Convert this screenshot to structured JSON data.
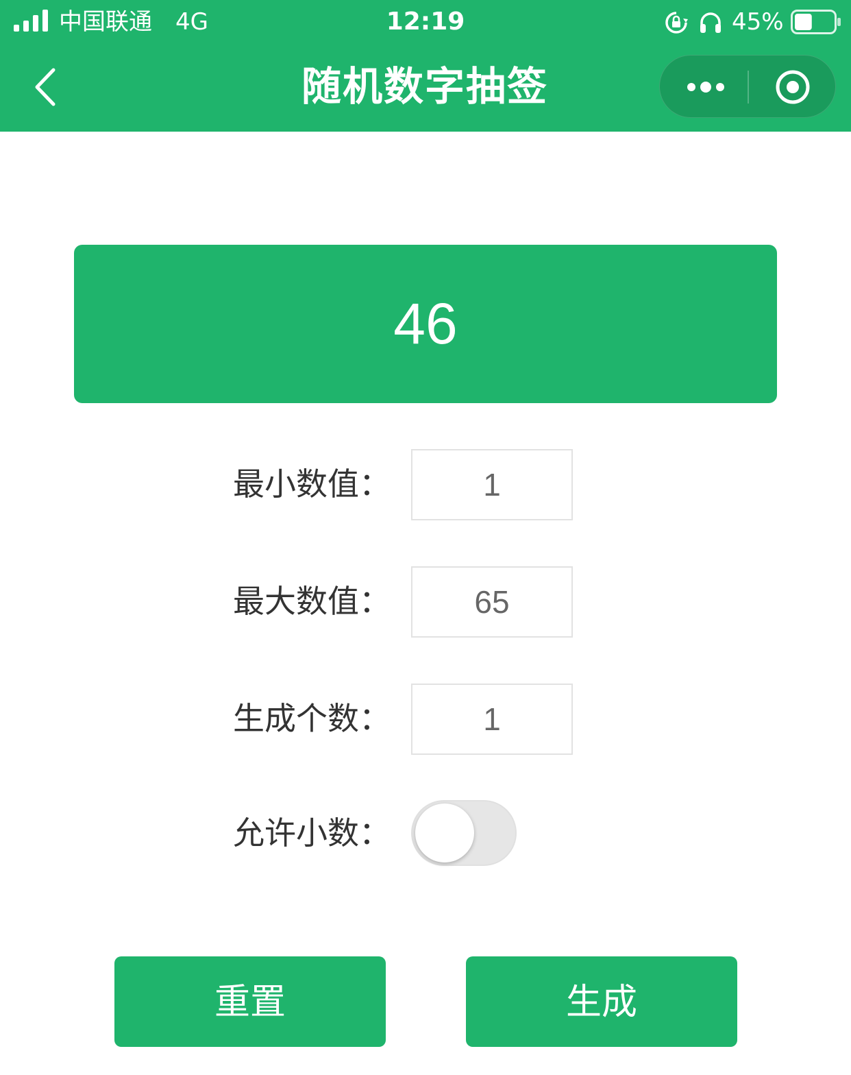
{
  "status_bar": {
    "carrier": "中国联通",
    "network": "4G",
    "time": "12:19",
    "battery_percent": "45%",
    "battery_level": 0.45,
    "icons": [
      "signal-icon",
      "rotation-lock-icon",
      "headphones-icon",
      "battery-icon"
    ]
  },
  "nav": {
    "title": "随机数字抽签",
    "back_icon": "chevron-left-icon",
    "more_icon": "more-dots-icon",
    "close_icon": "target-close-icon"
  },
  "result": {
    "value": "46"
  },
  "form": {
    "min_label": "最小数值：",
    "min_value": "1",
    "max_label": "最大数值：",
    "max_value": "65",
    "count_label": "生成个数：",
    "count_value": "1",
    "decimal_label": "允许小数：",
    "decimal_enabled": false
  },
  "buttons": {
    "reset_label": "重置",
    "generate_label": "生成"
  },
  "colors": {
    "primary": "#1fb46c",
    "capsule": "#1a9b5c",
    "text": "#333333",
    "input_text": "#666666"
  }
}
